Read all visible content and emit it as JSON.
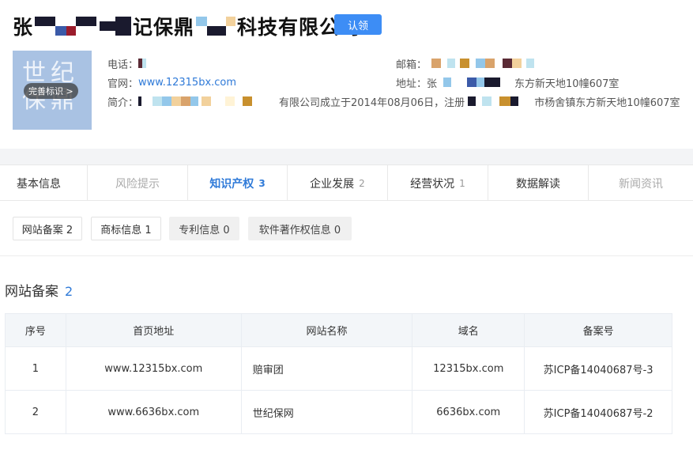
{
  "company": {
    "name_parts": [
      "张",
      "记保鼎",
      "科技有限公司"
    ],
    "claim_label": "认领",
    "logo_text": "世纪保鼎",
    "logo_badge": "完善标识 >",
    "phone_label": "电话：",
    "email_label": "邮箱：",
    "website_label": "官网：",
    "website": "www.12315bx.com",
    "address_label": "地址：",
    "address_parts": [
      "张",
      "东方新天地10幢607室"
    ],
    "intro_label": "简介：",
    "intro_parts": [
      "有限公司成立于2014年08月06日，注册",
      "市杨舍镇东方新天地10幢607室"
    ],
    "redaction_colors": [
      "#1a1a2e",
      "#3b5aa8",
      "#9b1c2c",
      "#d9a36b",
      "#93c7ea",
      "#f2d19c",
      "#bfe3ef",
      "#5a2a35",
      "#c8902e"
    ]
  },
  "main_tabs": [
    {
      "label": "基本信息",
      "count": "",
      "state": "normal"
    },
    {
      "label": "风险提示",
      "count": "",
      "state": "disabled"
    },
    {
      "label": "知识产权",
      "count": "3",
      "state": "active"
    },
    {
      "label": "企业发展",
      "count": "2",
      "state": "normal"
    },
    {
      "label": "经营状况",
      "count": "1",
      "state": "normal"
    },
    {
      "label": "数据解读",
      "count": "",
      "state": "normal"
    },
    {
      "label": "新闻资讯",
      "count": "",
      "state": "disabled"
    }
  ],
  "sub_tabs": [
    {
      "label": "网站备案 2",
      "style": "outlined"
    },
    {
      "label": "商标信息 1",
      "style": "outlined"
    },
    {
      "label": "专利信息 0",
      "style": "filled"
    },
    {
      "label": "软件著作权信息 0",
      "style": "filled"
    }
  ],
  "section": {
    "title": "网站备案",
    "count": "2"
  },
  "table": {
    "columns": [
      "序号",
      "首页地址",
      "网站名称",
      "域名",
      "备案号"
    ],
    "rows": [
      [
        "1",
        "www.12315bx.com",
        "赔审团",
        "12315bx.com",
        "苏ICP备14040687号-3"
      ],
      [
        "2",
        "www.6636bx.com",
        "世纪保网",
        "6636bx.com",
        "苏ICP备14040687号-2"
      ]
    ]
  },
  "colors": {
    "accent": "#2f7ad8",
    "claim_button": "#3d8df5",
    "logo_bg": "#a9c2e3"
  }
}
